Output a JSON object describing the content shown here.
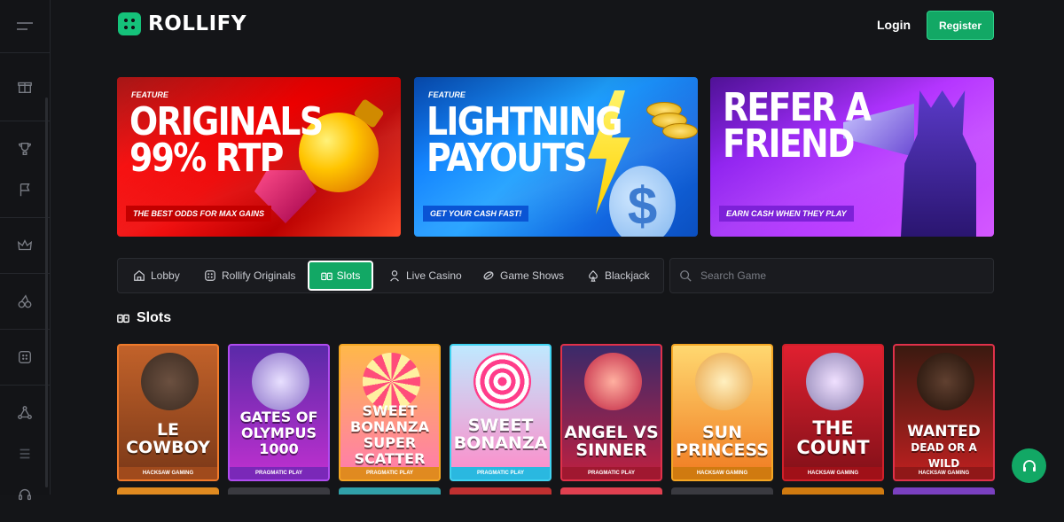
{
  "app": {
    "name": "ROLLIFY"
  },
  "header": {
    "login_label": "Login",
    "register_label": "Register"
  },
  "sidebar": {
    "items": [
      {
        "icon": "gift-icon"
      },
      {
        "icon": "trophy-icon"
      },
      {
        "icon": "flag-icon"
      },
      {
        "icon": "crown-icon"
      },
      {
        "icon": "cherries-icon"
      },
      {
        "icon": "originals-icon"
      },
      {
        "icon": "network-icon"
      },
      {
        "icon": "tokens-icon"
      },
      {
        "icon": "headset-icon"
      }
    ]
  },
  "banners": [
    {
      "tag": "FEATURE",
      "title_line1": "ORIGINALS",
      "title_line2": "99% RTP",
      "subtitle": "THE BEST ODDS FOR MAX GAINS"
    },
    {
      "tag": "FEATURE",
      "title_line1": "LIGHTNING",
      "title_line2": "PAYOUTS",
      "subtitle": "GET YOUR CASH FAST!"
    },
    {
      "tag": "",
      "title_line1": "REFER A",
      "title_line2": "FRIEND",
      "subtitle": "EARN CASH WHEN THEY PLAY"
    }
  ],
  "nav": {
    "tabs": [
      {
        "label": "Lobby",
        "icon": "home-icon"
      },
      {
        "label": "Rollify Originals",
        "icon": "originals-icon"
      },
      {
        "label": "Slots",
        "icon": "slots-icon",
        "active": true
      },
      {
        "label": "Live Casino",
        "icon": "dealer-icon"
      },
      {
        "label": "Game Shows",
        "icon": "gameshow-icon"
      },
      {
        "label": "Blackjack",
        "icon": "spade-icon"
      }
    ]
  },
  "search": {
    "placeholder": "Search Game"
  },
  "section": {
    "title": "Slots"
  },
  "games": [
    {
      "title_line1": "LE",
      "title_line2": "COWBOY",
      "provider": "HACKSAW GAMING",
      "border": "#f07a2a"
    },
    {
      "title_line1": "Gates of",
      "title_line2": "OLYMPUS 1000",
      "provider": "PRAGMATIC PLAY",
      "border": "#b04cf0"
    },
    {
      "title_line1": "SWEET",
      "title_line2": "BONANZA SUPER SCATTER",
      "provider": "PRAGMATIC PLAY",
      "border": "#f5a623"
    },
    {
      "title_line1": "SWEET",
      "title_line2": "BONANZA",
      "provider": "PRAGMATIC PLAY",
      "border": "#3fd2f0"
    },
    {
      "title_line1": "ANGEL vs",
      "title_line2": "SINNER",
      "provider": "PRAGMATIC PLAY",
      "border": "#e0314a"
    },
    {
      "title_line1": "SUN",
      "title_line2": "PRINCESS",
      "provider": "HACKSAW GAMING",
      "border": "#f5a623"
    },
    {
      "title_line1": "THE",
      "title_line2": "COUNT",
      "provider": "HACKSAW GAMING",
      "border": "#d0202a"
    },
    {
      "title_line1": "WANTED",
      "title_line2": "DEAD OR A WILD",
      "provider": "HACKSAW GAMING",
      "border": "#e0314a"
    }
  ],
  "colors": {
    "accent": "#12a865",
    "background": "#141518",
    "panel": "#1a1b1f"
  }
}
